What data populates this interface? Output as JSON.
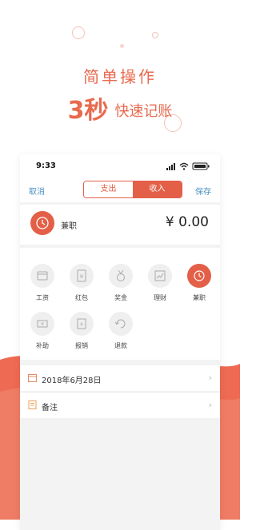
{
  "promo": {
    "line1": "简单操作",
    "highlight": "3秒",
    "line2_rest": "快速记账"
  },
  "status": {
    "time": "9:33"
  },
  "nav": {
    "cancel": "取消",
    "save": "保存",
    "tab_expense": "支出",
    "tab_income": "收入",
    "active_tab": "收入"
  },
  "entry": {
    "category": "兼职",
    "amount": "¥ 0.00"
  },
  "categories": [
    {
      "label": "工资",
      "icon": "wallet-icon"
    },
    {
      "label": "红包",
      "icon": "red-packet-icon"
    },
    {
      "label": "奖金",
      "icon": "medal-icon"
    },
    {
      "label": "理财",
      "icon": "chart-icon"
    },
    {
      "label": "兼职",
      "icon": "clock-icon",
      "selected": true
    },
    {
      "label": "补助",
      "icon": "allowance-icon"
    },
    {
      "label": "报销",
      "icon": "reimburse-icon"
    },
    {
      "label": "退款",
      "icon": "refund-icon"
    }
  ],
  "date_row": {
    "label": "2018年6月28日"
  },
  "note_row": {
    "label": "备注"
  },
  "colors": {
    "accent": "#e35f47",
    "link": "#4a90c2",
    "background_blob": "#ee6a52"
  }
}
